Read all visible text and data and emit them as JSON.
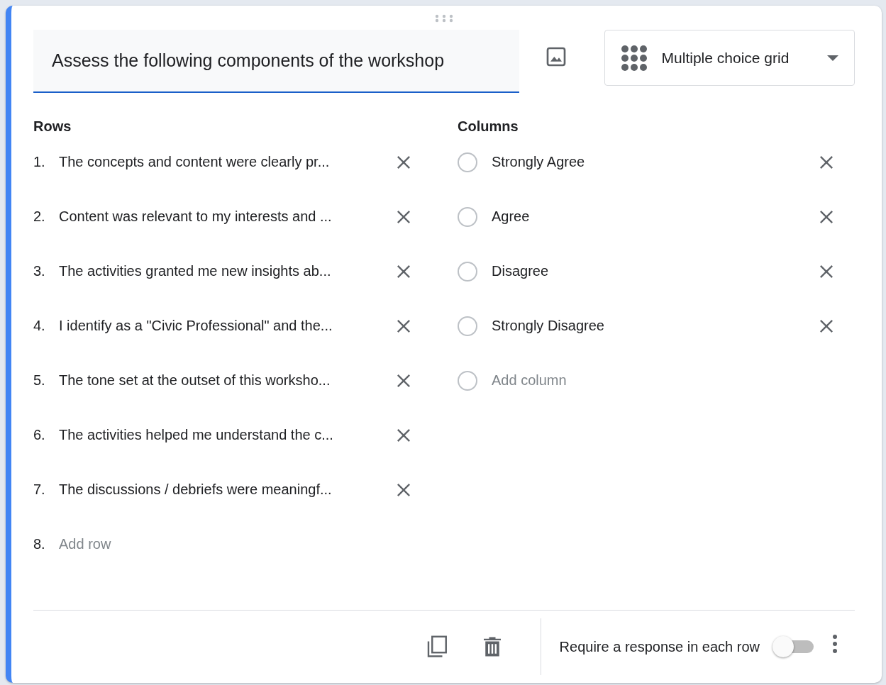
{
  "question": {
    "title": "Assess the following components of the workshop",
    "type": "Multiple choice grid"
  },
  "rows": {
    "heading": "Rows",
    "items": [
      {
        "number": "1.",
        "text": "The concepts and content were clearly pr..."
      },
      {
        "number": "2.",
        "text": "Content was relevant to my interests and ..."
      },
      {
        "number": "3.",
        "text": "The activities granted me new insights ab..."
      },
      {
        "number": "4.",
        "text": "I identify as a \"Civic Professional\" and the..."
      },
      {
        "number": "5.",
        "text": "The tone set at the outset of this worksho..."
      },
      {
        "number": "6.",
        "text": "The activities helped me understand the c..."
      },
      {
        "number": "7.",
        "text": "The discussions / debriefs were meaningf..."
      }
    ],
    "add": {
      "number": "8.",
      "label": "Add row"
    }
  },
  "columns": {
    "heading": "Columns",
    "items": [
      {
        "label": "Strongly Agree"
      },
      {
        "label": "Agree"
      },
      {
        "label": "Disagree"
      },
      {
        "label": "Strongly Disagree"
      }
    ],
    "add": {
      "label": "Add column"
    }
  },
  "footer": {
    "require_label": "Require a response in each row",
    "require_on": false
  }
}
